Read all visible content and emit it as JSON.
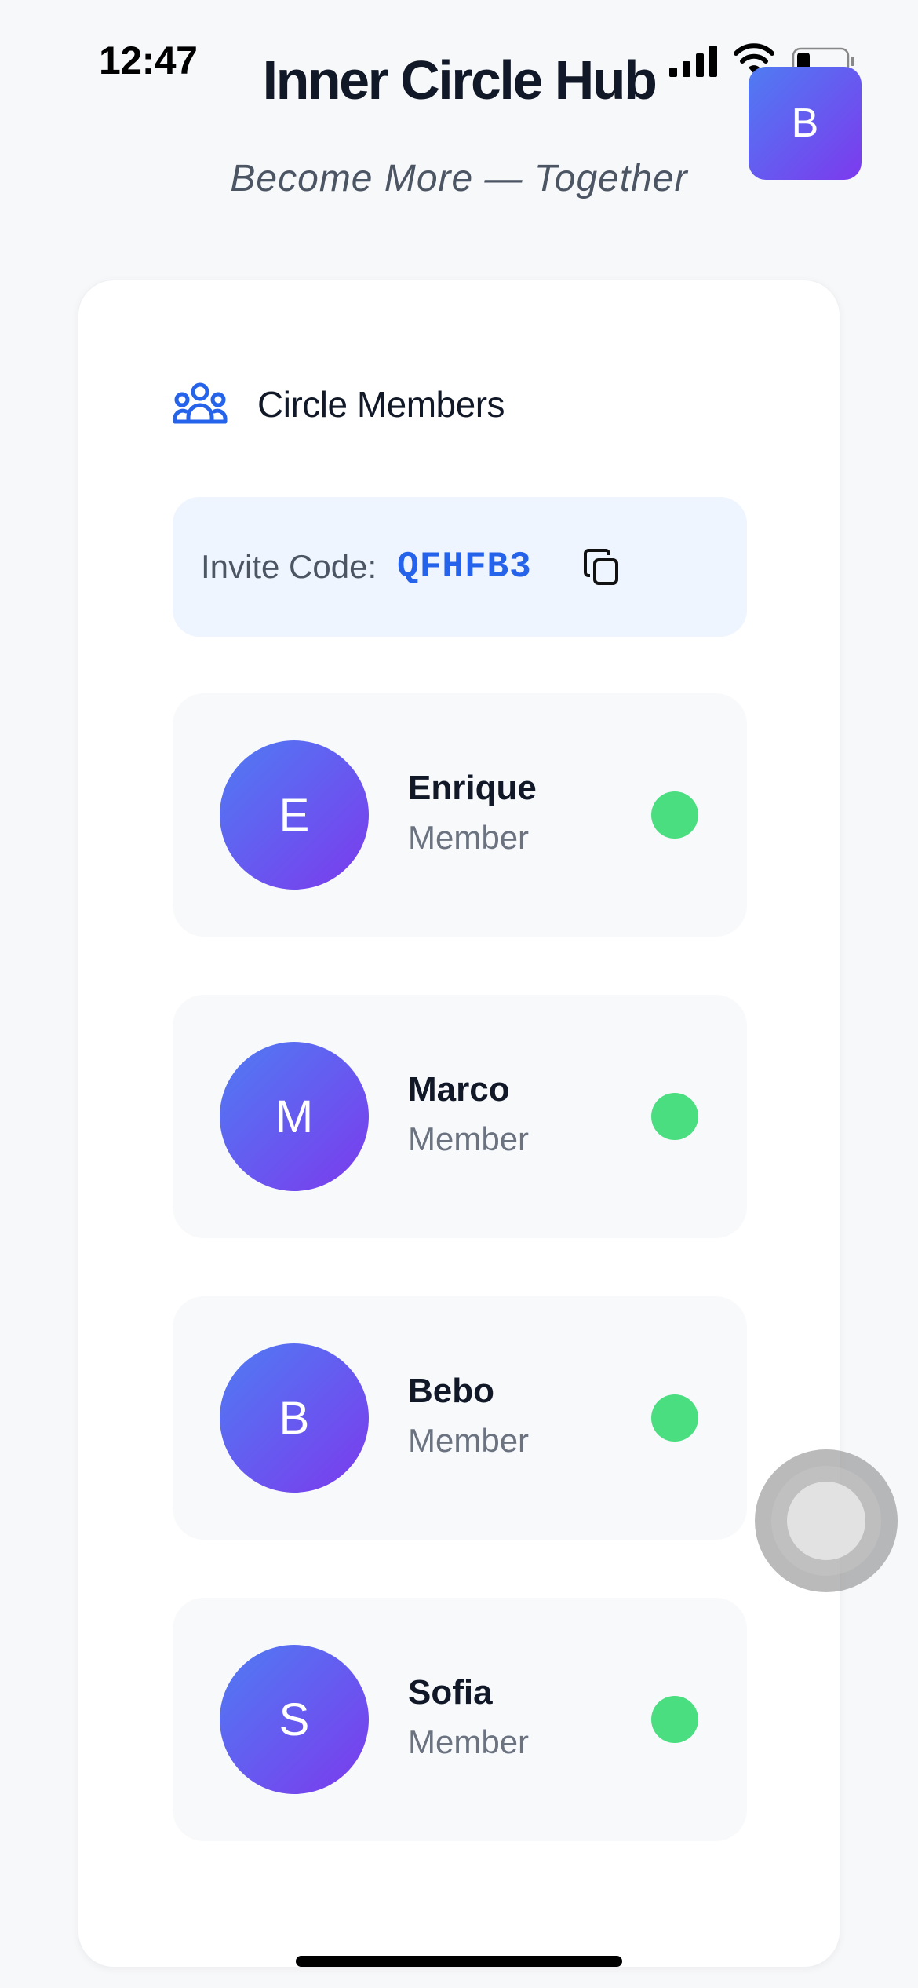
{
  "status_bar": {
    "time": "12:47"
  },
  "header": {
    "title": "Inner Circle Hub",
    "tagline": "Become More — Together",
    "profile_initial": "B"
  },
  "section": {
    "title": "Circle Members",
    "icon": "users-icon"
  },
  "invite": {
    "label": "Invite Code:",
    "code": "QFHFB3",
    "copy_icon": "copy-icon"
  },
  "members": [
    {
      "initial": "E",
      "name": "Enrique",
      "role": "Member",
      "status": "online"
    },
    {
      "initial": "M",
      "name": "Marco",
      "role": "Member",
      "status": "online"
    },
    {
      "initial": "B",
      "name": "Bebo",
      "role": "Member",
      "status": "online"
    },
    {
      "initial": "S",
      "name": "Sofia",
      "role": "Member",
      "status": "online"
    }
  ],
  "colors": {
    "accent": "#2563eb",
    "gradient_start": "#4f7cf3",
    "gradient_end": "#7c3aed",
    "online": "#4ade80"
  }
}
